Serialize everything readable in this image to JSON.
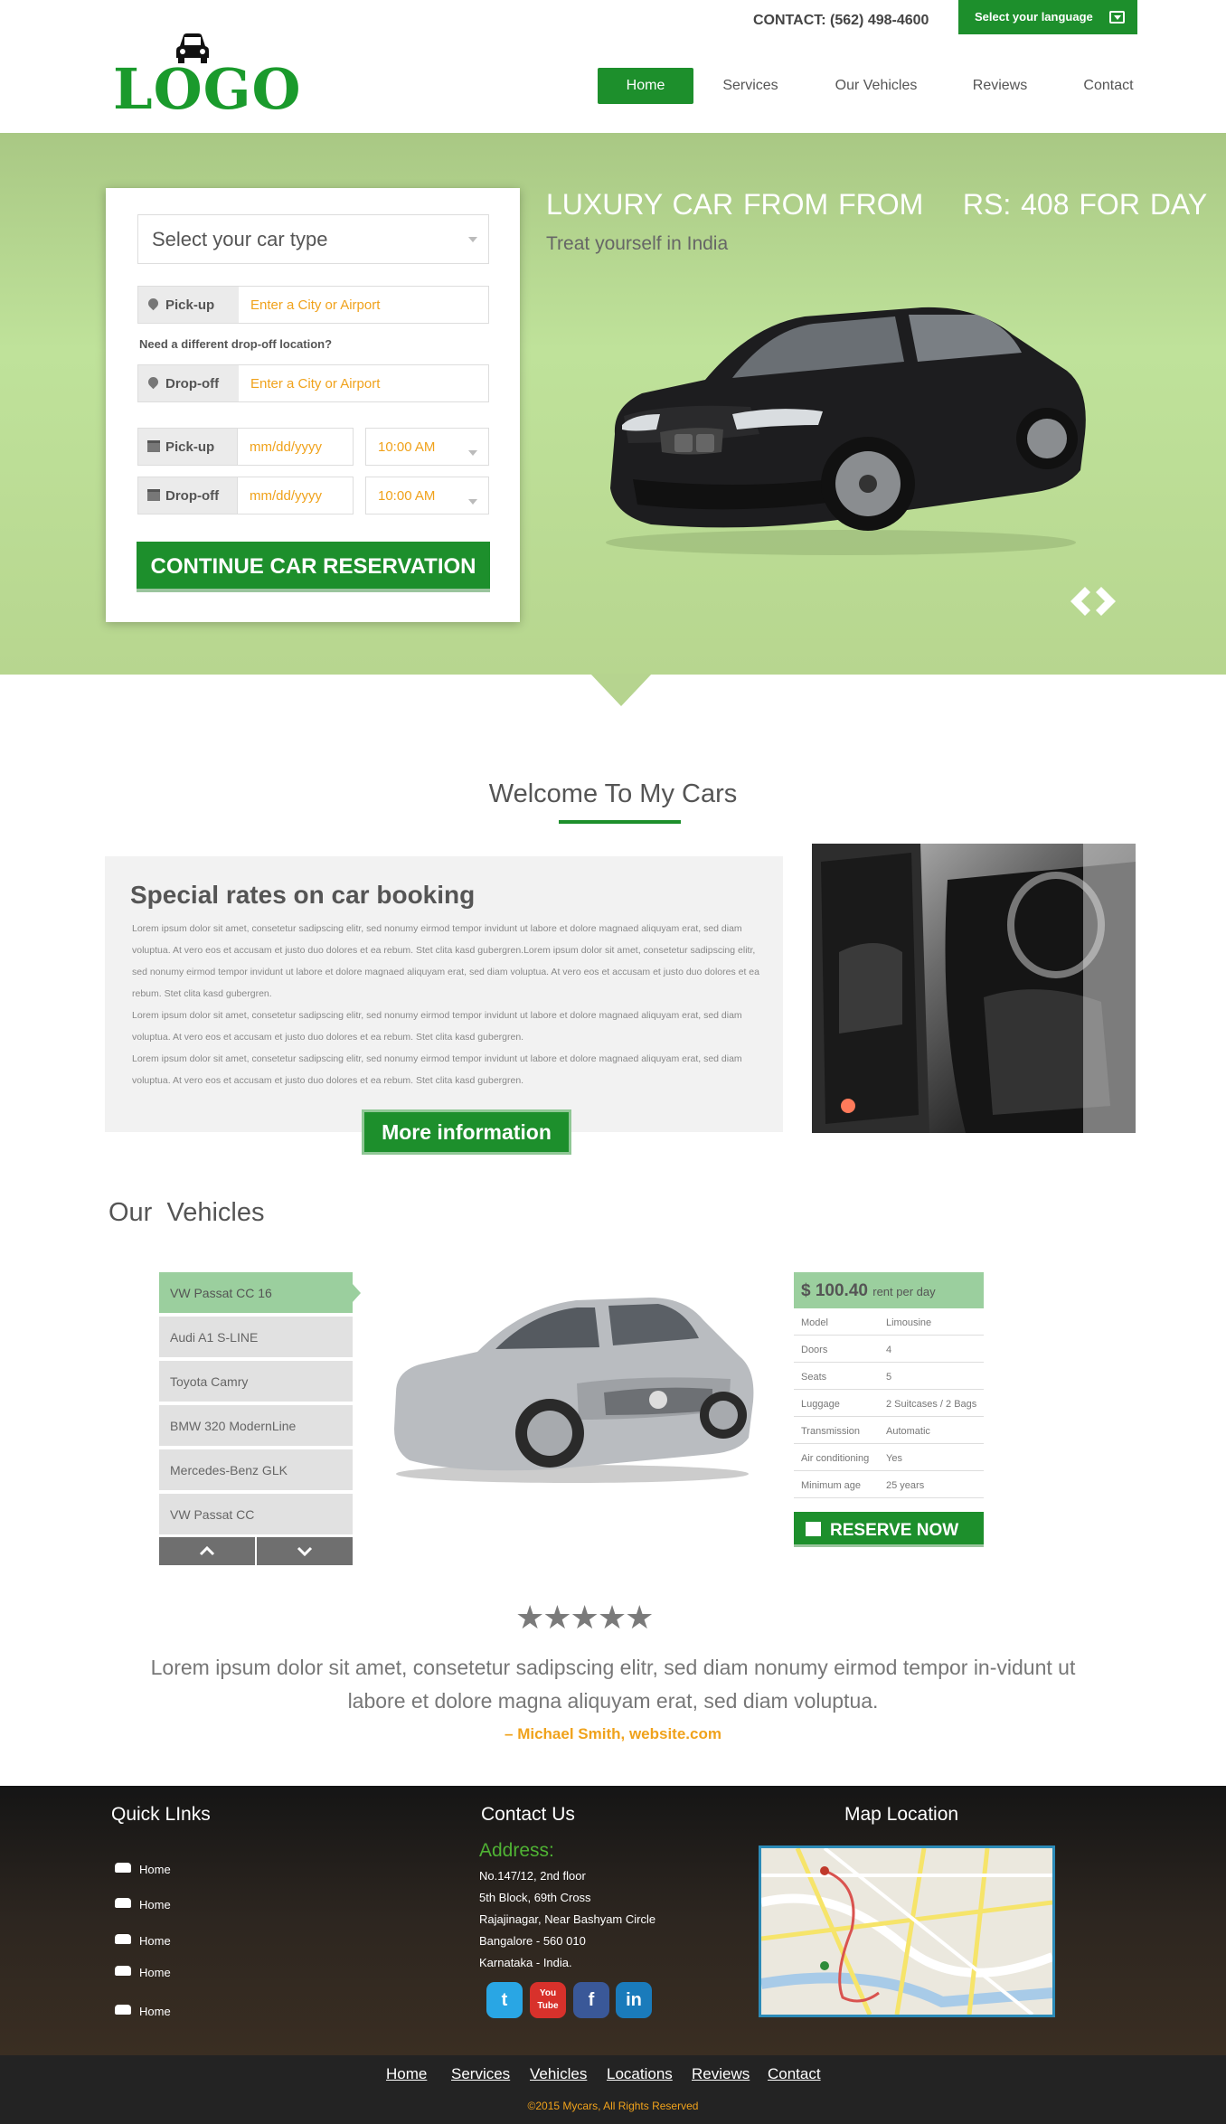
{
  "header": {
    "contact": "CONTACT: (562) 498-4600",
    "language": "Select your language",
    "logo": "LOGO",
    "nav": [
      "Home",
      "Services",
      "Our Vehicles",
      "Reviews",
      "Contact"
    ]
  },
  "booking": {
    "car_type": "Select your car type",
    "pickup_label": "Pick-up",
    "dropoff_label": "Drop-off",
    "location_placeholder": "Enter a City or Airport",
    "need_different": "Need a different drop-off location?",
    "date_placeholder": "mm/dd/yyyy",
    "time_value": "10:00 AM",
    "cta": "CONTINUE CAR RESERVATION"
  },
  "hero": {
    "title": "LUXURY CAR FROM FROM    RS: 408 FOR DAY",
    "subtitle": "Treat yourself in India"
  },
  "welcome": {
    "title": "Welcome To My Cars",
    "special_title": "Special rates on car booking",
    "special_body": "Lorem ipsum dolor sit amet, consetetur sadipscing elitr, sed  nonumy eirmod tempor invidunt ut labore et dolore magnaed aliquyam erat, sed diam voluptua. At vero eos et accusam et justo duo dolores et ea rebum. Stet clita kasd gubergren.Lorem ipsum dolor sit amet, consetetur sadipscing elitr, sed  nonumy eirmod tempor invidunt ut labore et dolore magnaed aliquyam erat, sed diam voluptua. At vero eos et accusam et justo duo dolores et ea rebum. Stet clita kasd gubergren.\nLorem ipsum dolor sit amet, consetetur sadipscing elitr, sed  nonumy eirmod tempor invidunt ut labore et dolore magnaed aliquyam erat, sed diam voluptua. At vero eos et accusam et justo duo dolores et ea rebum. Stet clita kasd gubergren.\nLorem ipsum dolor sit amet, consetetur sadipscing elitr, sed  nonumy eirmod tempor invidunt ut labore et dolore magnaed aliquyam erat, sed diam voluptua. At vero eos et accusam et justo duo dolores et ea rebum. Stet clita kasd gubergren.",
    "more": "More information"
  },
  "vehicles": {
    "title": "Our  Vehicles",
    "list": [
      "VW Passat CC 16",
      "Audi A1 S-LINE",
      "Toyota Camry",
      "BMW 320 ModernLine",
      "Mercedes-Benz GLK",
      "VW Passat CC"
    ],
    "price": "$ 100.40",
    "price_unit": "rent per day",
    "specs": [
      {
        "k": "Model",
        "v": "Limousine"
      },
      {
        "k": "Doors",
        "v": "4"
      },
      {
        "k": "Seats",
        "v": "5"
      },
      {
        "k": "Luggage",
        "v": "2 Suitcases / 2 Bags"
      },
      {
        "k": "Transmission",
        "v": "Automatic"
      },
      {
        "k": "Air conditioning",
        "v": "Yes"
      },
      {
        "k": "Minimum age",
        "v": "25 years"
      }
    ],
    "reserve": "RESERVE NOW"
  },
  "testimonial": {
    "rating": 5,
    "stars": "★★★★★",
    "quote": "Lorem ipsum dolor sit amet, consetetur sadipscing elitr, sed diam nonumy eirmod tempor in-vidunt ut labore et dolore magna aliquyam erat, sed diam voluptua.",
    "author": "– Michael Smith, website.com"
  },
  "footer": {
    "quick_links_title": "Quick LInks",
    "quick_links": [
      "Home",
      "Home",
      "Home",
      "Home",
      "Home"
    ],
    "contact_title": "Contact Us",
    "address_title": "Address:",
    "address": [
      "No.147/12, 2nd floor",
      "5th Block, 69th Cross",
      "Rajajinagar, Near Bashyam Circle",
      "Bangalore - 560 010",
      "Karnataka - India."
    ],
    "map_title": "Map Location",
    "social": [
      "t",
      "You Tube",
      "f",
      "in"
    ],
    "bottom_links": [
      "Home",
      "Services",
      "Vehicles",
      "Locations",
      "Reviews",
      "Contact"
    ],
    "copyright": "©2015 Mycars, All Rights Reserved"
  }
}
